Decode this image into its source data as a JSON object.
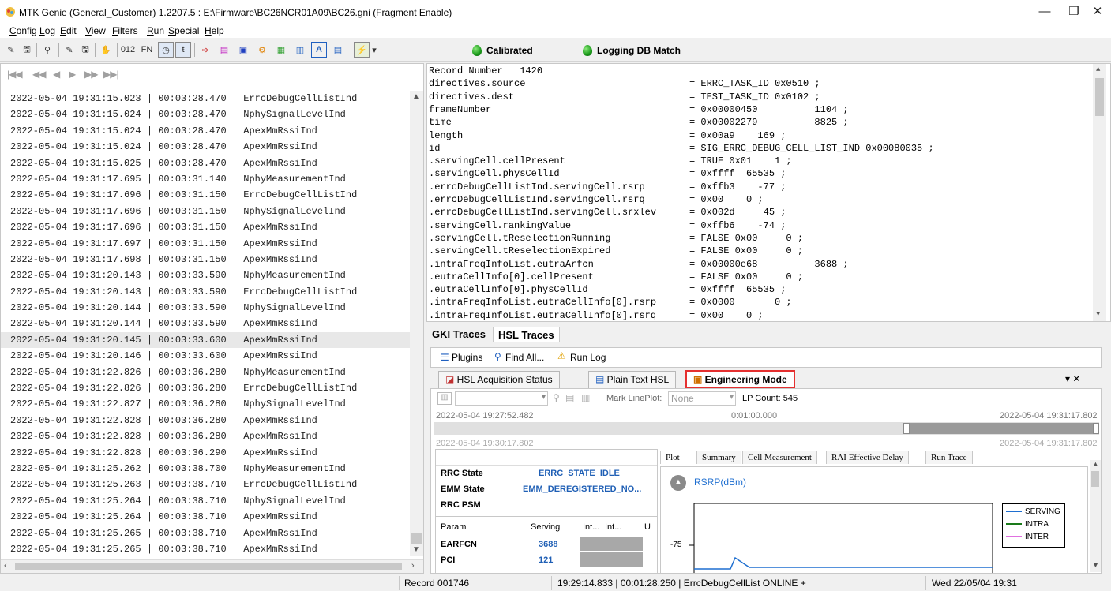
{
  "window": {
    "title": "MTK Genie (General_Customer) 1.2207.5 : E:\\Firmware\\BC26NCR01A09\\BC26.gni  (Fragment Enable)",
    "minimize_glyph": "—",
    "maximize_glyph": "❐",
    "close_glyph": "✕"
  },
  "menu": [
    {
      "u": "C",
      "rest": "onfig"
    },
    {
      "u": "L",
      "rest": "og"
    },
    {
      "u": "E",
      "rest": "dit"
    },
    {
      "u": "V",
      "rest": "iew"
    },
    {
      "u": "F",
      "rest": "ilters"
    },
    {
      "u": "R",
      "rest": "un"
    },
    {
      "u": "S",
      "rest": "pecial"
    },
    {
      "u": "H",
      "rest": "elp"
    }
  ],
  "toolbar": {
    "text_buttons": [
      "012",
      "FN"
    ],
    "calibrated_label": "Calibrated",
    "logging_label": "Logging DB Match",
    "accent": "#1a9a1a"
  },
  "left": {
    "nav_glyphs": [
      "|◀◀",
      "◀◀",
      "◀",
      "▶",
      "▶▶",
      "▶▶|"
    ],
    "rows": [
      "2022-05-04 19:31:15.023 | 00:03:28.470 | ErrcDebugCellListInd",
      "2022-05-04 19:31:15.024 | 00:03:28.470 | NphySignalLevelInd",
      "2022-05-04 19:31:15.024 | 00:03:28.470 | ApexMmRssiInd",
      "2022-05-04 19:31:15.024 | 00:03:28.470 | ApexMmRssiInd",
      "2022-05-04 19:31:15.025 | 00:03:28.470 | ApexMmRssiInd",
      "2022-05-04 19:31:17.695 | 00:03:31.140 | NphyMeasurementInd",
      "2022-05-04 19:31:17.696 | 00:03:31.150 | ErrcDebugCellListInd",
      "2022-05-04 19:31:17.696 | 00:03:31.150 | NphySignalLevelInd",
      "2022-05-04 19:31:17.696 | 00:03:31.150 | ApexMmRssiInd",
      "2022-05-04 19:31:17.697 | 00:03:31.150 | ApexMmRssiInd",
      "2022-05-04 19:31:17.698 | 00:03:31.150 | ApexMmRssiInd",
      "2022-05-04 19:31:20.143 | 00:03:33.590 | NphyMeasurementInd",
      "2022-05-04 19:31:20.143 | 00:03:33.590 | ErrcDebugCellListInd",
      "2022-05-04 19:31:20.144 | 00:03:33.590 | NphySignalLevelInd",
      "2022-05-04 19:31:20.144 | 00:03:33.590 | ApexMmRssiInd",
      "2022-05-04 19:31:20.145 | 00:03:33.600 | ApexMmRssiInd",
      "2022-05-04 19:31:20.146 | 00:03:33.600 | ApexMmRssiInd",
      "2022-05-04 19:31:22.826 | 00:03:36.280 | NphyMeasurementInd",
      "2022-05-04 19:31:22.826 | 00:03:36.280 | ErrcDebugCellListInd",
      "2022-05-04 19:31:22.827 | 00:03:36.280 | NphySignalLevelInd",
      "2022-05-04 19:31:22.828 | 00:03:36.280 | ApexMmRssiInd",
      "2022-05-04 19:31:22.828 | 00:03:36.280 | ApexMmRssiInd",
      "2022-05-04 19:31:22.828 | 00:03:36.290 | ApexMmRssiInd",
      "2022-05-04 19:31:25.262 | 00:03:38.700 | NphyMeasurementInd",
      "2022-05-04 19:31:25.263 | 00:03:38.710 | ErrcDebugCellListInd",
      "2022-05-04 19:31:25.264 | 00:03:38.710 | NphySignalLevelInd",
      "2022-05-04 19:31:25.264 | 00:03:38.710 | ApexMmRssiInd",
      "2022-05-04 19:31:25.265 | 00:03:38.710 | ApexMmRssiInd",
      "2022-05-04 19:31:25.265 | 00:03:38.710 | ApexMmRssiInd"
    ],
    "selected_row": 15
  },
  "detail": {
    "header": "Record Number   1420",
    "lines": [
      [
        "directives.source",
        "= ERRC_TASK_ID 0x0510 ;"
      ],
      [
        "directives.dest",
        "= TEST_TASK_ID 0x0102 ;"
      ],
      [
        "frameNumber",
        "= 0x00000450          1104 ;"
      ],
      [
        "time",
        "= 0x00002279          8825 ;"
      ],
      [
        "length",
        "= 0x00a9    169 ;"
      ],
      [
        "id",
        "= SIG_ERRC_DEBUG_CELL_LIST_IND 0x00080035 ;"
      ],
      [
        ".servingCell.cellPresent",
        "= TRUE 0x01    1 ;"
      ],
      [
        ".servingCell.physCellId",
        "= 0xffff  65535 ;"
      ],
      [
        ".errcDebugCellListInd.servingCell.rsrp",
        "= 0xffb3    -77 ;"
      ],
      [
        ".errcDebugCellListInd.servingCell.rsrq",
        "= 0x00    0 ;"
      ],
      [
        ".errcDebugCellListInd.servingCell.srxlev",
        "= 0x002d     45 ;"
      ],
      [
        ".servingCell.rankingValue",
        "= 0xffb6    -74 ;"
      ],
      [
        ".servingCell.tReselectionRunning",
        "= FALSE 0x00     0 ;"
      ],
      [
        ".servingCell.tReselectionExpired",
        "= FALSE 0x00     0 ;"
      ],
      [
        ".intraFreqInfoList.eutraArfcn",
        "= 0x00000e68          3688 ;"
      ],
      [
        ".eutraCellInfo[0].cellPresent",
        "= FALSE 0x00     0 ;"
      ],
      [
        ".eutraCellInfo[0].physCellId",
        "= 0xffff  65535 ;"
      ],
      [
        ".intraFreqInfoList.eutraCellInfo[0].rsrp",
        "= 0x0000       0 ;"
      ],
      [
        ".intraFreqInfoList.eutraCellInfo[0].rsrq",
        "= 0x00    0 ;"
      ]
    ]
  },
  "trace_tabs": [
    "GKI Traces",
    "HSL Traces"
  ],
  "plugin_bar": {
    "plugins": "Plugins",
    "find_all": "Find All...",
    "run_log": "Run Log"
  },
  "sub_tabs": [
    "HSL Acquisition Status",
    "Plain Text HSL",
    "Engineering Mode"
  ],
  "sub_close": "▾ ✕",
  "eng": {
    "mark_lineplot_label": "Mark LinePlot:",
    "mark_lineplot_value": "None",
    "lp_count": "LP Count:  545",
    "time_start": "2022-05-04 19:27:52.482",
    "time_mid": "0:01:00.000",
    "time_end": "2022-05-04 19:31:17.802",
    "time_start2": "2022-05-04 19:30:17.802",
    "time_end2": "2022-05-04 19:31:17.802",
    "plot_tabs": [
      "Plot",
      "Summary",
      "Cell Measurement",
      "RAI Effective Delay",
      "Run Trace"
    ],
    "states": [
      {
        "label": "RRC State",
        "value": "ERRC_STATE_IDLE"
      },
      {
        "label": "EMM State",
        "value": "EMM_DEREGISTERED_NO..."
      },
      {
        "label": "RRC PSM",
        "value": ""
      }
    ],
    "param_headers": [
      "Param",
      "Serving",
      "Int...",
      "Int...",
      "U"
    ],
    "params": [
      {
        "label": "EARFCN",
        "value": "3688"
      },
      {
        "label": "PCI",
        "value": "121"
      }
    ],
    "plot_title": "RSRP(dBm)",
    "y_tick": "-75",
    "legend": [
      "SERVING",
      "INTRA",
      "INTER"
    ],
    "legend_colors": [
      "#1f6fd0",
      "#1a7a1a",
      "#e070e0"
    ]
  },
  "status": {
    "record": "Record 001746",
    "info": "19:29:14.833 | 00:01:28.250 | ErrcDebugCellList ONLINE +",
    "date": "Wed 22/05/04 19:31"
  }
}
